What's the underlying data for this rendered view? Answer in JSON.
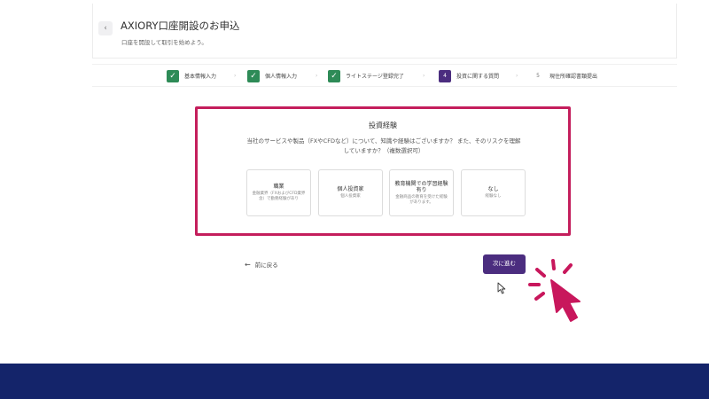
{
  "header": {
    "back_icon": "chevron-left-icon",
    "back_glyph": "‹",
    "title": "AXIORY口座開設のお申込",
    "subtitle": "口座を開設して取引を始めよう。"
  },
  "stepper": {
    "steps": [
      {
        "mark": "✓",
        "label": "基本情報入力",
        "state": "done"
      },
      {
        "mark": "✓",
        "label": "個人情報入力",
        "state": "done"
      },
      {
        "mark": "✓",
        "label": "ライトステージ登録完了",
        "state": "done"
      },
      {
        "mark": "4",
        "label": "投資に関する質問",
        "state": "current"
      },
      {
        "mark": "5",
        "label": "現住所確認書類提出",
        "state": "pending"
      }
    ],
    "separator": "›"
  },
  "question": {
    "title": "投資経験",
    "description": "当社のサービスや製品（FXやCFDなど）について、知識や経験はございますか？ また、そのリスクを理解していますか？（複数選択可）",
    "options": [
      {
        "title": "職業",
        "sub": "金融業界（FXおよびCFD業界含）で勤務経験があり"
      },
      {
        "title": "個人投資家",
        "sub": "個人投資家"
      },
      {
        "title": "教育機関での学習経験有り",
        "sub": "金融商品の教育を受けた経験があります。"
      },
      {
        "title": "なし",
        "sub": "経験なし"
      }
    ]
  },
  "nav": {
    "back_label": "前に戻る",
    "back_arrow": "←",
    "next_label": "次に進む"
  },
  "colors": {
    "accent": "#4b2d7f",
    "done": "#2e8b57",
    "highlight_border": "#c41e5c",
    "hand_cursor": "#c8175c",
    "footer": "#14246a"
  },
  "icons": {
    "mouse_cursor": "mouse-pointer-icon",
    "hand_cursor": "hand-pointer-click-icon"
  }
}
